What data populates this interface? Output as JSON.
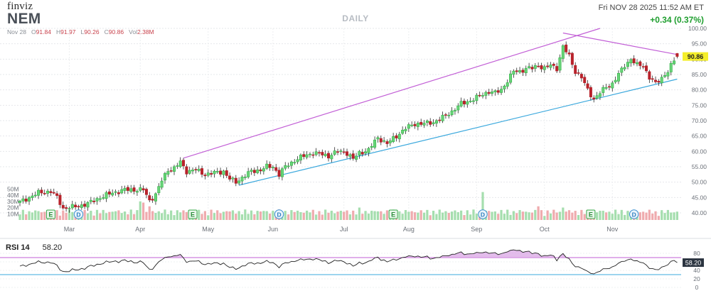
{
  "header": {
    "logo": "finviz",
    "ticker": "NEM",
    "interval": "DAILY",
    "datetime": "Fri NOV 28 2025 11:52 AM ET",
    "change": "+0.34 (0.37%)",
    "ohlc": {
      "date": "Nov 28",
      "open_label": "O",
      "open": "91.84",
      "high_label": "H",
      "high": "91.97",
      "low_label": "L",
      "low": "90.26",
      "close_label": "C",
      "close": "90.86",
      "vol_label": "Vol",
      "vol": "2.38M"
    }
  },
  "colors": {
    "up": "#2fb344",
    "up_fill": "#69d379",
    "down": "#b8222b",
    "trend_upper": "#c25fd6",
    "trend_lower": "#3aa8dd",
    "rsi_line": "#222222",
    "rsi_overbought": "#c25fd6",
    "rsi_oversold": "#3aa8dd",
    "price_tag": "#f4ee2a"
  },
  "chart_data": [
    {
      "type": "candlestick",
      "title": "NEM",
      "interval": "DAILY",
      "y_ticks": [
        "100.00",
        "95.00",
        "90.00",
        "85.00",
        "80.00",
        "75.00",
        "70.00",
        "65.00",
        "60.00",
        "55.00",
        "50.00",
        "45.00",
        "40.00"
      ],
      "ylim": [
        38,
        100
      ],
      "month_labels": [
        "Mar",
        "Apr",
        "May",
        "Jun",
        "Jul",
        "Aug",
        "Sep",
        "Oct",
        "Nov"
      ],
      "last_price": "90.86",
      "close_anchors": [
        [
          0,
          43.5
        ],
        [
          6,
          46.5
        ],
        [
          10,
          47
        ],
        [
          12,
          45
        ],
        [
          14,
          41.5
        ],
        [
          18,
          42
        ],
        [
          22,
          43
        ],
        [
          26,
          45
        ],
        [
          30,
          46.5
        ],
        [
          34,
          47.5
        ],
        [
          38,
          47.5
        ],
        [
          40,
          47.5
        ],
        [
          42,
          44
        ],
        [
          44,
          46
        ],
        [
          46,
          50.5
        ],
        [
          48,
          54
        ],
        [
          50,
          54.5
        ],
        [
          52,
          56.5
        ],
        [
          54,
          53.5
        ],
        [
          57,
          54
        ],
        [
          60,
          52.5
        ],
        [
          63,
          53
        ],
        [
          66,
          53.5
        ],
        [
          68,
          51
        ],
        [
          70,
          50
        ],
        [
          72,
          51.5
        ],
        [
          75,
          53.5
        ],
        [
          78,
          54
        ],
        [
          80,
          55
        ],
        [
          82,
          55
        ],
        [
          84,
          52.5
        ],
        [
          86,
          55
        ],
        [
          89,
          57
        ],
        [
          92,
          58.5
        ],
        [
          95,
          59.5
        ],
        [
          98,
          59
        ],
        [
          100,
          58.5
        ],
        [
          103,
          60
        ],
        [
          106,
          59.5
        ],
        [
          108,
          57.5
        ],
        [
          110,
          59.5
        ],
        [
          113,
          60.5
        ],
        [
          116,
          64.5
        ],
        [
          119,
          62.5
        ],
        [
          122,
          65
        ],
        [
          125,
          67.5
        ],
        [
          128,
          69
        ],
        [
          131,
          69
        ],
        [
          134,
          69.5
        ],
        [
          137,
          71
        ],
        [
          140,
          73
        ],
        [
          143,
          75.5
        ],
        [
          146,
          76.5
        ],
        [
          149,
          78
        ],
        [
          152,
          79.5
        ],
        [
          154,
          79
        ],
        [
          156,
          80
        ],
        [
          158,
          83
        ],
        [
          160,
          86
        ],
        [
          162,
          86
        ],
        [
          164,
          87
        ],
        [
          166,
          87
        ],
        [
          168,
          88
        ],
        [
          170,
          87
        ],
        [
          172,
          88
        ],
        [
          174,
          87
        ],
        [
          176,
          94
        ],
        [
          178,
          91
        ],
        [
          180,
          86
        ],
        [
          182,
          84
        ],
        [
          184,
          80
        ],
        [
          186,
          77
        ],
        [
          188,
          79
        ],
        [
          190,
          81
        ],
        [
          192,
          82
        ],
        [
          194,
          85
        ],
        [
          196,
          88
        ],
        [
          198,
          90
        ],
        [
          200,
          88
        ],
        [
          202,
          88
        ],
        [
          204,
          84
        ],
        [
          206,
          82
        ],
        [
          208,
          84
        ],
        [
          210,
          86
        ],
        [
          212,
          89.5
        ],
        [
          213,
          90.86
        ]
      ],
      "ohlc_last": {
        "open": 91.84,
        "high": 91.97,
        "low": 90.26,
        "close": 90.86
      }
    },
    {
      "type": "bar",
      "title": "Volume",
      "y_ticks": [
        "50M",
        "40M",
        "30M",
        "20M",
        "10M"
      ],
      "ylim": [
        0,
        65
      ],
      "spike_bars": [
        [
          39,
          30
        ],
        [
          40,
          28
        ],
        [
          42,
          22
        ],
        [
          150,
          45
        ],
        [
          110,
          20
        ],
        [
          168,
          22
        ],
        [
          176,
          20
        ],
        [
          206,
          14
        ]
      ],
      "events": [
        {
          "label": "E",
          "bar": 10
        },
        {
          "label": "D",
          "bar": 19
        },
        {
          "label": "E",
          "bar": 56
        },
        {
          "label": "D",
          "bar": 84
        },
        {
          "label": "E",
          "bar": 121
        },
        {
          "label": "D",
          "bar": 150
        },
        {
          "label": "E",
          "bar": 185
        },
        {
          "label": "D",
          "bar": 199
        }
      ]
    },
    {
      "type": "line",
      "title": "RSI 14",
      "value": "58.20",
      "y_ticks": [
        "80",
        "60",
        "40",
        "20",
        "0"
      ],
      "ylim": [
        0,
        100
      ],
      "overbought": 70,
      "oversold": 30
    }
  ]
}
